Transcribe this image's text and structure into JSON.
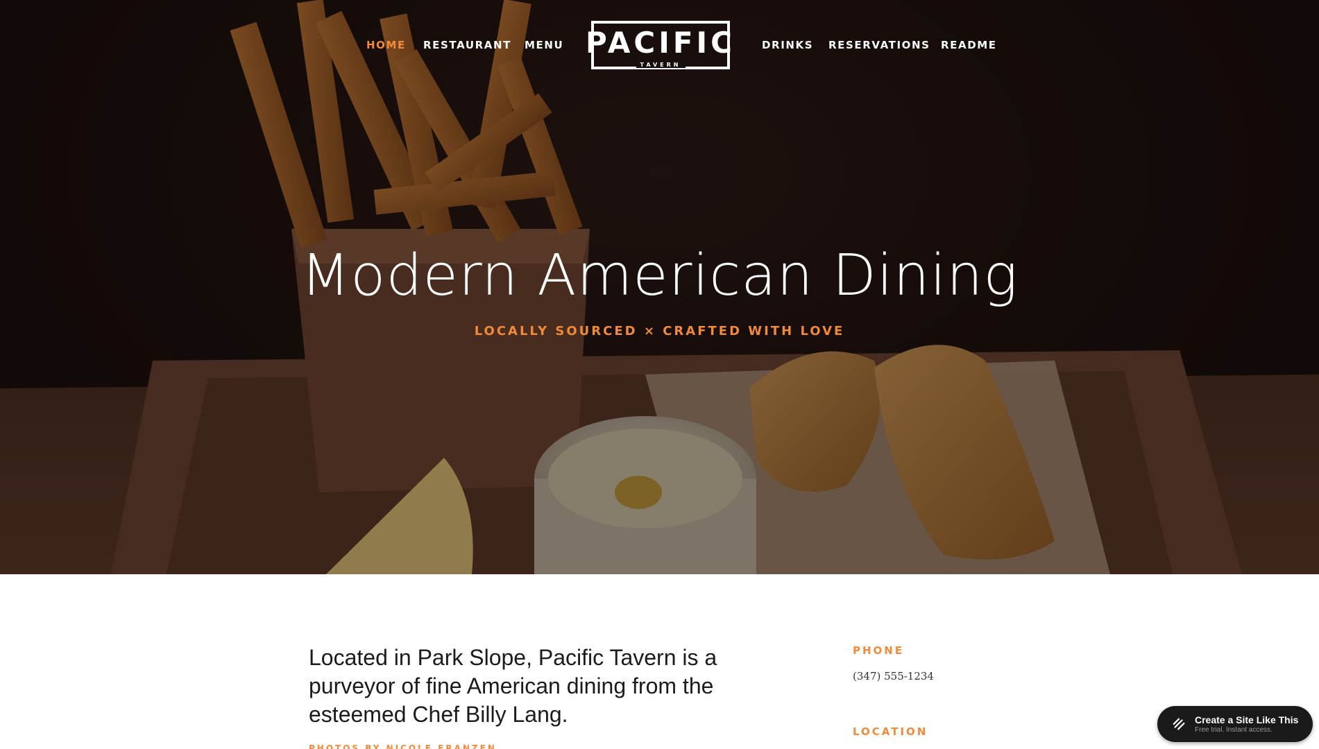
{
  "nav": {
    "items": [
      {
        "label": "HOME",
        "active": true
      },
      {
        "label": "RESTAURANT",
        "active": false
      },
      {
        "label": "MENU",
        "active": false
      },
      {
        "label": "DRINKS",
        "active": false
      },
      {
        "label": "RESERVATIONS",
        "active": false
      },
      {
        "label": "README",
        "active": false
      }
    ]
  },
  "logo": {
    "title": "PACIFIC",
    "subtitle": "TAVERN"
  },
  "hero": {
    "title": "Modern American Dining",
    "subtitle": "LOCALLY SOURCED × CRAFTED WITH LOVE"
  },
  "content": {
    "intro": "Located in Park Slope, Pacific Tavern is a purveyor of fine American dining from the esteemed Chef Billy Lang.",
    "photo_credit": "PHOTOS BY NICOLE FRANZEN",
    "phone_label": "PHONE",
    "phone_value": "(347) 555-1234",
    "location_label": "LOCATION"
  },
  "badge": {
    "title": "Create a Site Like This",
    "subtitle": "Free trial. Instant access.",
    "icon": "squarespace-icon"
  },
  "colors": {
    "accent": "#f28a3b",
    "hero_bg": "#140d0b",
    "text_dark": "#1b1b1b",
    "badge_bg": "#1a1a1a"
  }
}
